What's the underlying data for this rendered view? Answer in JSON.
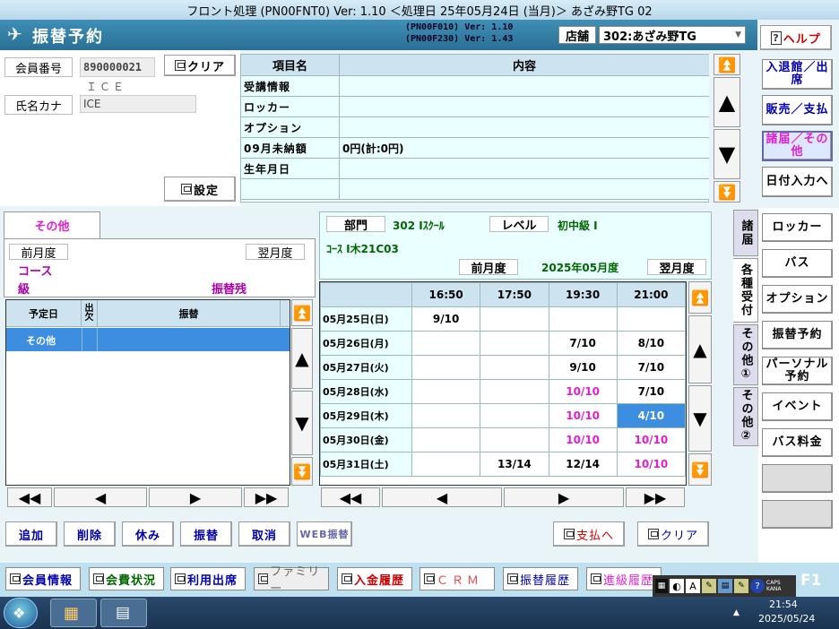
{
  "window": {
    "title": "フロント処理 (PN00FNT0) Ver: 1.10 ＜処理日 25年05月24日 (当月)＞ あざみ野TG 02"
  },
  "header": {
    "title": "振替予約",
    "ver1": "(PN00F010) Ver: 1.10",
    "ver2": "(PN00F230) Ver: 1.43",
    "store_label": "店舗",
    "store_value": "302:あざみ野TG",
    "help": "ヘルプ"
  },
  "member": {
    "no_label": "会員番号",
    "no_value": "890000021",
    "name_sub": "ＩＣＥ",
    "kana_label": "氏名カナ",
    "kana_value": "ICE",
    "clear": "クリア",
    "setting": "設定"
  },
  "info_table": {
    "col_item": "項目名",
    "col_content": "内容",
    "rows": [
      {
        "item": "受講情報",
        "content": ""
      },
      {
        "item": "ロッカー",
        "content": ""
      },
      {
        "item": "オプション",
        "content": ""
      },
      {
        "item": "09月未納額",
        "content": "0円(計:0円)"
      },
      {
        "item": "生年月日",
        "content": ""
      },
      {
        "item": "",
        "content": ""
      }
    ]
  },
  "left_panel": {
    "tab": "その他",
    "prev_month": "前月度",
    "next_month": "翌月度",
    "course": "コース",
    "level": "級",
    "transfer_remain": "振替残",
    "cols": {
      "date": "予定日",
      "attend": "出欠",
      "transfer": "振替"
    },
    "rows": [
      {
        "date": "その他",
        "attend": "",
        "transfer": ""
      }
    ]
  },
  "schedule": {
    "dept_label": "部門",
    "dept_value": "302 Iｽｸｰﾙ",
    "level_label": "レベル",
    "level_value": "初中級 I",
    "course": "ｺｰｽ I木21C03",
    "prev_month": "前月度",
    "month": "2025年05月度",
    "next_month": "翌月度",
    "times": [
      "16:50",
      "17:50",
      "19:30",
      "21:00"
    ],
    "rows": [
      {
        "date": "05月25日(日)",
        "cells": [
          "9/10",
          "",
          "",
          ""
        ]
      },
      {
        "date": "05月26日(月)",
        "cells": [
          "",
          "",
          "7/10",
          "8/10"
        ]
      },
      {
        "date": "05月27日(火)",
        "cells": [
          "",
          "",
          "9/10",
          "7/10"
        ]
      },
      {
        "date": "05月28日(水)",
        "cells": [
          "",
          "",
          "10/10",
          "7/10"
        ]
      },
      {
        "date": "05月29日(木)",
        "cells": [
          "",
          "",
          "10/10",
          "4/10"
        ]
      },
      {
        "date": "05月30日(金)",
        "cells": [
          "",
          "",
          "10/10",
          "10/10"
        ]
      },
      {
        "date": "05月31日(土)",
        "cells": [
          "",
          "13/14",
          "12/14",
          "10/10"
        ]
      }
    ]
  },
  "bottom_buttons": {
    "add": "追加",
    "delete": "削除",
    "rest": "休み",
    "transfer": "振替",
    "cancel": "取消",
    "web": "WEB振替",
    "pay": "支払へ",
    "clear": "クリア"
  },
  "right_nav": [
    "入退館／出席",
    "販売／支払",
    "諸届／その他",
    "日付入力へ"
  ],
  "vtabs": [
    "諸届",
    "各種受付",
    "その他①",
    "その他②"
  ],
  "side_buttons": [
    "ロッカー",
    "バス",
    "オプション",
    "振替予約",
    "パーソナル予約",
    "イベント",
    "バス料金"
  ],
  "footer": [
    "会員情報",
    "会費状況",
    "利用出席",
    "ファミリー",
    "入金履歴",
    "ＣＲＭ",
    "振替履歴",
    "進級履歴"
  ],
  "taskbar": {
    "time": "21:54",
    "date": "2025/05/24",
    "ime": "CAPS KANA",
    "fkey": "F1"
  },
  "colors": {
    "accent": "#2a6f95",
    "magenta": "#e020d0",
    "selected": "#3d8ee0"
  }
}
